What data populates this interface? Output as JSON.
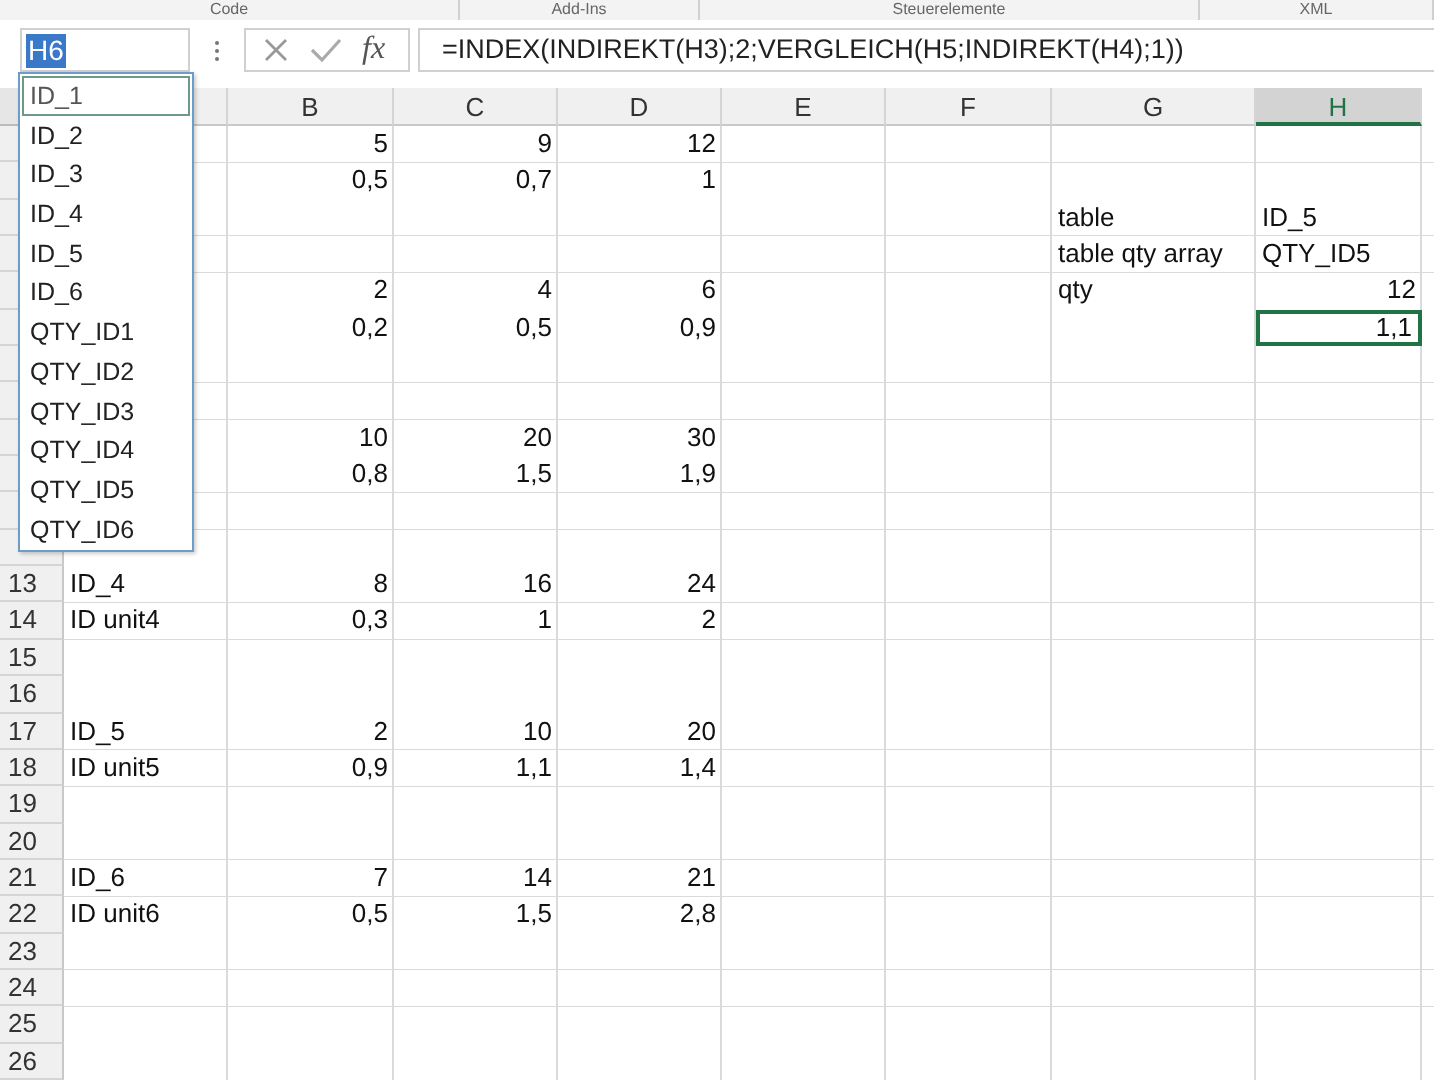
{
  "ribbon_groups": [
    "Code",
    "Add-Ins",
    "Steuerelemente",
    "XML"
  ],
  "name_box": {
    "value": "H6",
    "text_selected": true
  },
  "formula_bar": {
    "function_button": "fx",
    "formula": "=INDEX(INDIREKT(H3);2;VERGLEICH(H5;INDIREKT(H4);1))"
  },
  "name_list": [
    {
      "label": "ID_1",
      "selected": true
    },
    {
      "label": "ID_2",
      "selected": false
    },
    {
      "label": "ID_3",
      "selected": false
    },
    {
      "label": "ID_4",
      "selected": false
    },
    {
      "label": "ID_5",
      "selected": false
    },
    {
      "label": "ID_6",
      "selected": false
    },
    {
      "label": "QTY_ID1",
      "selected": false
    },
    {
      "label": "QTY_ID2",
      "selected": false
    },
    {
      "label": "QTY_ID3",
      "selected": false
    },
    {
      "label": "QTY_ID4",
      "selected": false
    },
    {
      "label": "QTY_ID5",
      "selected": false
    },
    {
      "label": "QTY_ID6",
      "selected": false
    }
  ],
  "columns": [
    {
      "label": "B",
      "selected": false
    },
    {
      "label": "C",
      "selected": false
    },
    {
      "label": "D",
      "selected": false
    },
    {
      "label": "E",
      "selected": false
    },
    {
      "label": "F",
      "selected": false
    },
    {
      "label": "G",
      "selected": false
    },
    {
      "label": "H",
      "selected": true
    }
  ],
  "rows": [
    {
      "cells": {
        "B": {
          "value": "5",
          "kind": "number",
          "selected": false
        },
        "C": {
          "value": "9",
          "kind": "number",
          "selected": false
        },
        "D": {
          "value": "12",
          "kind": "number",
          "selected": false
        }
      }
    },
    {
      "cells": {
        "B": {
          "value": "0,5",
          "kind": "number",
          "selected": false
        },
        "C": {
          "value": "0,7",
          "kind": "number",
          "selected": false
        },
        "D": {
          "value": "1",
          "kind": "number",
          "selected": false
        }
      }
    },
    {
      "cells": {
        "G": {
          "value": "table",
          "kind": "text",
          "selected": false
        },
        "H": {
          "value": "ID_5",
          "kind": "text",
          "selected": false
        }
      }
    },
    {
      "cells": {
        "G": {
          "value": "table qty array",
          "kind": "text",
          "selected": false
        },
        "H": {
          "value": "QTY_ID5",
          "kind": "text",
          "selected": false
        }
      }
    },
    {
      "cells": {
        "B": {
          "value": "2",
          "kind": "number",
          "selected": false
        },
        "C": {
          "value": "4",
          "kind": "number",
          "selected": false
        },
        "D": {
          "value": "6",
          "kind": "number",
          "selected": false
        },
        "G": {
          "value": "qty",
          "kind": "text",
          "selected": false
        },
        "H": {
          "value": "12",
          "kind": "number",
          "selected": false
        }
      }
    },
    {
      "cells": {
        "B": {
          "value": "0,2",
          "kind": "number",
          "selected": false
        },
        "C": {
          "value": "0,5",
          "kind": "number",
          "selected": false
        },
        "D": {
          "value": "0,9",
          "kind": "number",
          "selected": false
        },
        "H": {
          "value": "1,1",
          "kind": "number",
          "selected": true
        }
      }
    },
    {},
    {},
    {
      "cells": {
        "B": {
          "value": "10",
          "kind": "number",
          "selected": false
        },
        "C": {
          "value": "20",
          "kind": "number",
          "selected": false
        },
        "D": {
          "value": "30",
          "kind": "number",
          "selected": false
        }
      }
    },
    {
      "cells": {
        "B": {
          "value": "0,8",
          "kind": "number",
          "selected": false
        },
        "C": {
          "value": "1,5",
          "kind": "number",
          "selected": false
        },
        "D": {
          "value": "1,9",
          "kind": "number",
          "selected": false
        }
      }
    },
    {},
    {},
    {
      "number": "13",
      "cells": {
        "A": {
          "value": "ID_4",
          "kind": "text",
          "selected": false
        },
        "B": {
          "value": "8",
          "kind": "number",
          "selected": false
        },
        "C": {
          "value": "16",
          "kind": "number",
          "selected": false
        },
        "D": {
          "value": "24",
          "kind": "number",
          "selected": false
        }
      }
    },
    {
      "number": "14",
      "cells": {
        "A": {
          "value": "ID unit4",
          "kind": "text",
          "selected": false
        },
        "B": {
          "value": "0,3",
          "kind": "number",
          "selected": false
        },
        "C": {
          "value": "1",
          "kind": "number",
          "selected": false
        },
        "D": {
          "value": "2",
          "kind": "number",
          "selected": false
        }
      }
    },
    {
      "number": "15"
    },
    {
      "number": "16"
    },
    {
      "number": "17",
      "cells": {
        "A": {
          "value": "ID_5",
          "kind": "text",
          "selected": false
        },
        "B": {
          "value": "2",
          "kind": "number",
          "selected": false
        },
        "C": {
          "value": "10",
          "kind": "number",
          "selected": false
        },
        "D": {
          "value": "20",
          "kind": "number",
          "selected": false
        }
      }
    },
    {
      "number": "18",
      "cells": {
        "A": {
          "value": "ID unit5",
          "kind": "text",
          "selected": false
        },
        "B": {
          "value": "0,9",
          "kind": "number",
          "selected": false
        },
        "C": {
          "value": "1,1",
          "kind": "number",
          "selected": false
        },
        "D": {
          "value": "1,4",
          "kind": "number",
          "selected": false
        }
      }
    },
    {
      "number": "19"
    },
    {
      "number": "20"
    },
    {
      "number": "21",
      "cells": {
        "A": {
          "value": "ID_6",
          "kind": "text",
          "selected": false
        },
        "B": {
          "value": "7",
          "kind": "number",
          "selected": false
        },
        "C": {
          "value": "14",
          "kind": "number",
          "selected": false
        },
        "D": {
          "value": "21",
          "kind": "number",
          "selected": false
        }
      }
    },
    {
      "number": "22",
      "cells": {
        "A": {
          "value": "ID unit6",
          "kind": "text",
          "selected": false
        },
        "B": {
          "value": "0,5",
          "kind": "number",
          "selected": false
        },
        "C": {
          "value": "1,5",
          "kind": "number",
          "selected": false
        },
        "D": {
          "value": "2,8",
          "kind": "number",
          "selected": false
        }
      }
    },
    {
      "number": "23"
    },
    {
      "number": "24"
    },
    {
      "number": "25"
    },
    {
      "number": "26"
    }
  ]
}
